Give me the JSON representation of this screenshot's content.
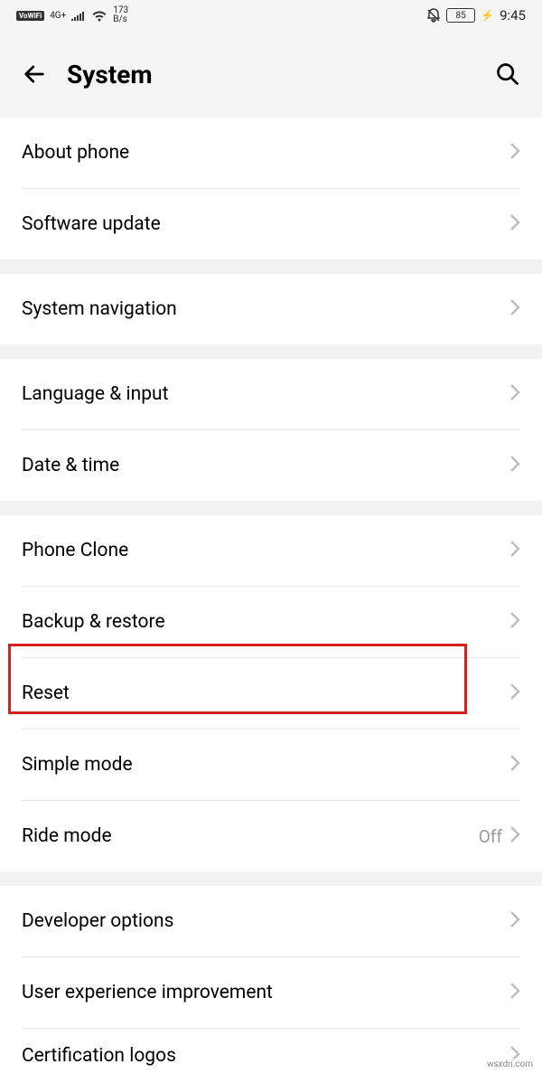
{
  "status": {
    "vowifi": "VoWiFi",
    "signal": "4G+",
    "speed_top": "173",
    "speed_bottom": "B/s",
    "battery": "85",
    "time": "9:45"
  },
  "header": {
    "title": "System"
  },
  "groups": [
    {
      "items": [
        {
          "id": "about-phone",
          "label": "About phone"
        },
        {
          "id": "software-update",
          "label": "Software update"
        }
      ]
    },
    {
      "items": [
        {
          "id": "system-navigation",
          "label": "System navigation"
        }
      ]
    },
    {
      "items": [
        {
          "id": "language-input",
          "label": "Language & input"
        },
        {
          "id": "date-time",
          "label": "Date & time"
        }
      ]
    },
    {
      "items": [
        {
          "id": "phone-clone",
          "label": "Phone Clone"
        },
        {
          "id": "backup-restore",
          "label": "Backup & restore"
        },
        {
          "id": "reset",
          "label": "Reset",
          "highlighted": true
        },
        {
          "id": "simple-mode",
          "label": "Simple mode"
        },
        {
          "id": "ride-mode",
          "label": "Ride mode",
          "value": "Off"
        }
      ]
    },
    {
      "items": [
        {
          "id": "developer-options",
          "label": "Developer options"
        },
        {
          "id": "user-experience",
          "label": "User experience improvement"
        },
        {
          "id": "certification-logos",
          "label": "Certification logos"
        }
      ]
    }
  ],
  "watermark": "wsxdn.com"
}
